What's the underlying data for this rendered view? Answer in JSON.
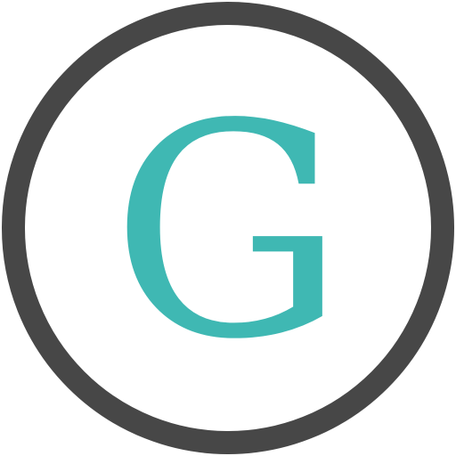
{
  "logo": {
    "letter": "G",
    "letter_color": "#3fb8b3",
    "ring_color": "#474747",
    "background_color": "#ffffff"
  }
}
